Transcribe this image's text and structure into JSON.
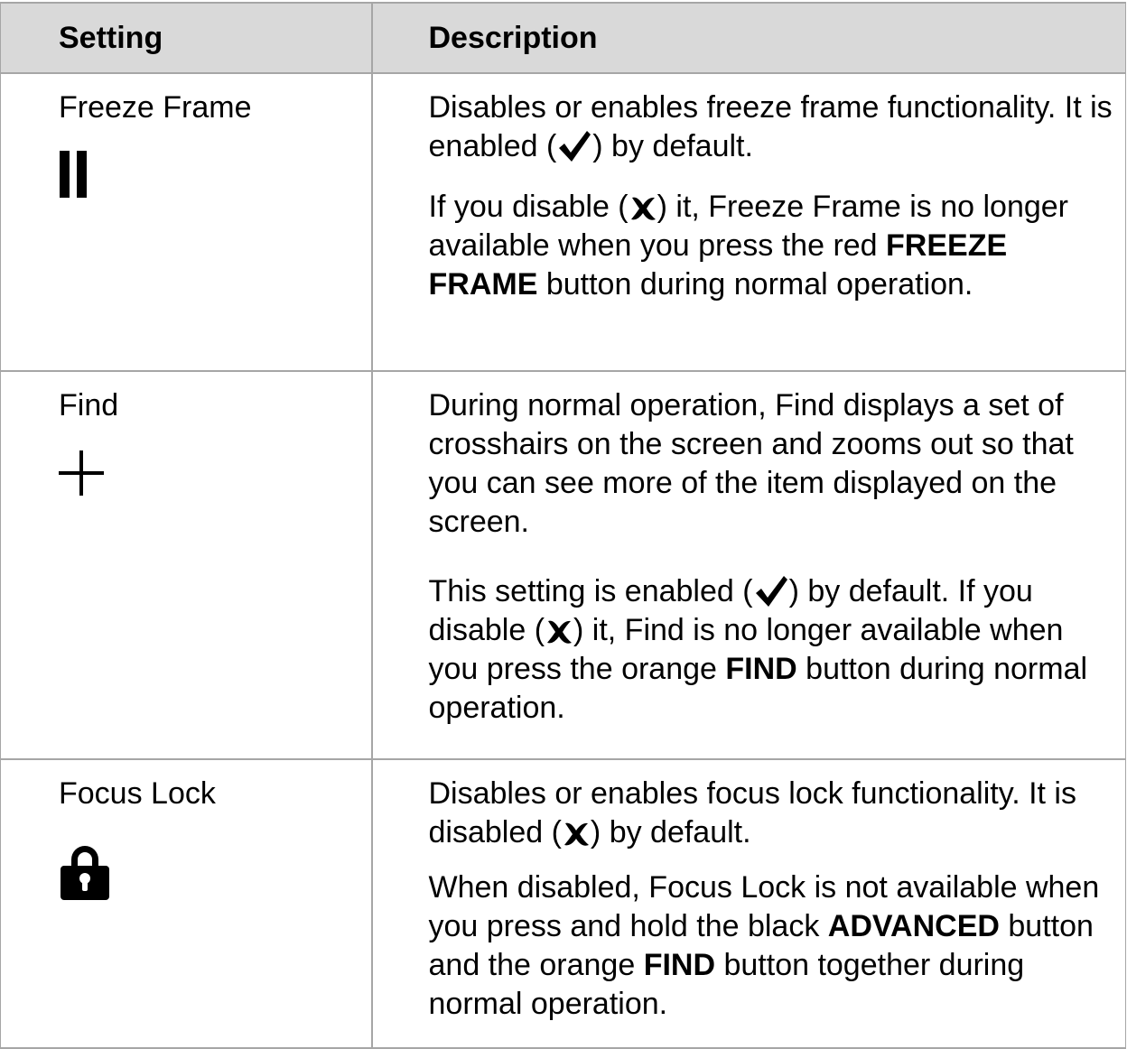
{
  "table": {
    "headers": {
      "setting": "Setting",
      "description": "Description"
    },
    "rows": [
      {
        "setting": "Freeze Frame",
        "icon": "pause-icon",
        "paragraphs": [
          {
            "p1": "Disables or enables freeze frame functionality. It is enabled (",
            "p2": ") by default."
          },
          {
            "p1": "If you disable (",
            "p2": ") it, Freeze Frame is no longer available when you press the red ",
            "bold": "FREEZE FRAME",
            "p3": " button during normal operation."
          }
        ]
      },
      {
        "setting": "Find",
        "icon": "crosshair-icon",
        "paragraphs": [
          {
            "p1": "During normal operation, Find displays a set of crosshairs on the screen and zooms out so that you can see more of the item displayed on the screen."
          },
          {
            "p1": "This setting is enabled (",
            "p2": ") by default. If you disable (",
            "p3": ") it, Find is no longer available when you press the orange ",
            "bold": "FIND",
            "p4": " button during normal operation."
          }
        ]
      },
      {
        "setting": "Focus Lock",
        "icon": "lock-icon",
        "paragraphs": [
          {
            "p1": "Disables or enables focus lock functionality. It is disabled (",
            "p2": ") by default."
          },
          {
            "p1": "When disabled, Focus Lock is not available when you press and hold the black ",
            "bold1": "ADVANCED",
            "p2": " button and the orange ",
            "bold2": "FIND",
            "p3": " button together during normal operation."
          }
        ]
      }
    ]
  },
  "colors": {
    "header_background": "#d9d9d9",
    "border": "#a6a6a6",
    "text": "#000000"
  }
}
